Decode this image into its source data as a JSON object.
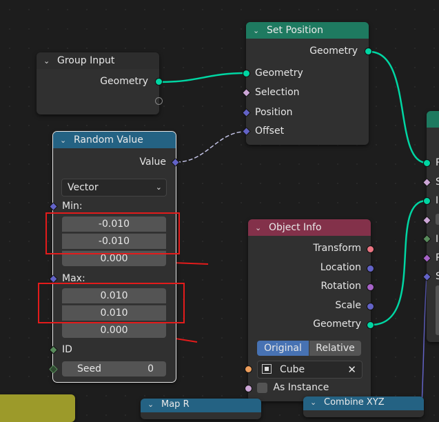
{
  "group_input": {
    "title": "Group Input",
    "out_geometry": "Geometry"
  },
  "set_position": {
    "title": "Set Position",
    "out_geometry": "Geometry",
    "in_geometry": "Geometry",
    "in_selection": "Selection",
    "in_position": "Position",
    "in_offset": "Offset"
  },
  "random_value": {
    "title": "Random Value",
    "out_value": "Value",
    "type_dropdown": "Vector",
    "min_label": "Min:",
    "min_values": [
      "-0.010",
      "-0.010",
      "0.000"
    ],
    "max_label": "Max:",
    "max_values": [
      "0.010",
      "0.010",
      "0.000"
    ],
    "id_label": "ID",
    "seed_label": "Seed",
    "seed_value": "0"
  },
  "object_info": {
    "title": "Object Info",
    "out_transform": "Transform",
    "out_location": "Location",
    "out_rotation": "Rotation",
    "out_scale": "Scale",
    "out_geometry": "Geometry",
    "mode_original": "Original",
    "mode_relative": "Relative",
    "object_name": "Cube",
    "as_instance": "As Instance"
  },
  "partial_nodes": {
    "bottom_mid": "Map R",
    "bottom_right": "Combine XYZ"
  },
  "right_node_letters": [
    "P",
    "S",
    "I",
    "",
    "I",
    "R",
    "S"
  ],
  "colors": {
    "header_geometry": "#1e7a60",
    "header_input": "#2d2d2d",
    "header_converter": "#246283",
    "header_input_obj": "#83314a",
    "annotation_red": "#e41b1b"
  }
}
